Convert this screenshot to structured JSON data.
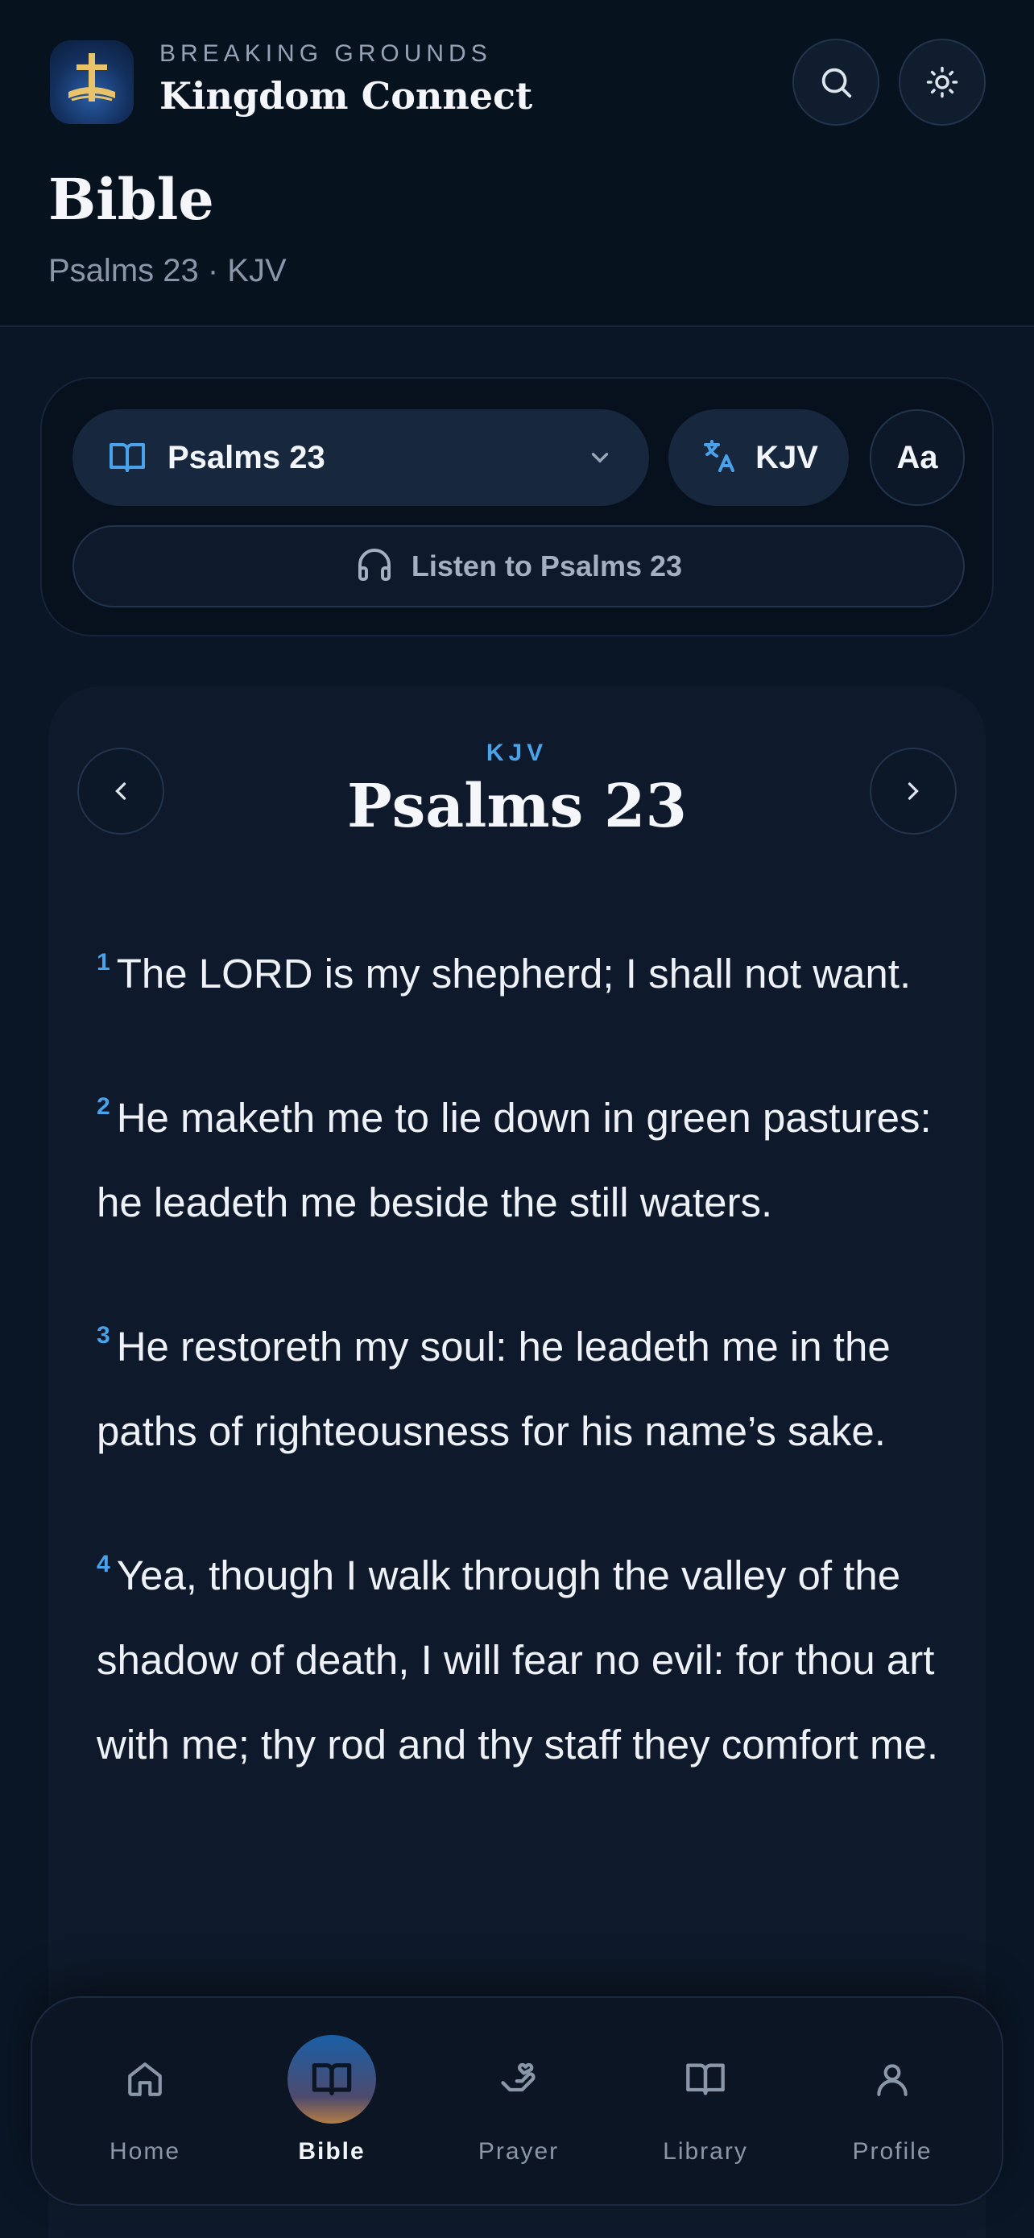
{
  "brand": {
    "subtitle": "BREAKING GROUNDS",
    "title": "Kingdom Connect"
  },
  "header": {
    "title": "Bible",
    "subtitle": "Psalms 23 · KJV"
  },
  "controls": {
    "book_select": "Psalms 23",
    "version": "KJV",
    "font_size_button": "Aa",
    "listen": "Listen to Psalms 23"
  },
  "reader": {
    "version": "KJV",
    "chapter_title": "Psalms 23",
    "verses": [
      {
        "num": "1",
        "text": "The LORD is my shepherd; I shall not want."
      },
      {
        "num": "2",
        "text": "He maketh me to lie down in green pastures: he leadeth me beside the still waters."
      },
      {
        "num": "3",
        "text": "He restoreth my soul: he leadeth me in the paths of righteousness for his name’s sake."
      },
      {
        "num": "4",
        "text": "Yea, though I walk through the valley of the shadow of death, I will fear no evil: for thou art with me; thy rod and thy staff they comfort me."
      }
    ]
  },
  "nav": {
    "items": [
      {
        "label": "Home",
        "icon": "home-icon"
      },
      {
        "label": "Bible",
        "icon": "book-icon",
        "active": true
      },
      {
        "label": "Prayer",
        "icon": "hand-heart-icon"
      },
      {
        "label": "Library",
        "icon": "library-icon"
      },
      {
        "label": "Profile",
        "icon": "user-icon"
      }
    ]
  },
  "colors": {
    "background": "#0a1626",
    "accent": "#4aa3ea",
    "gold": "#d8b45a"
  }
}
